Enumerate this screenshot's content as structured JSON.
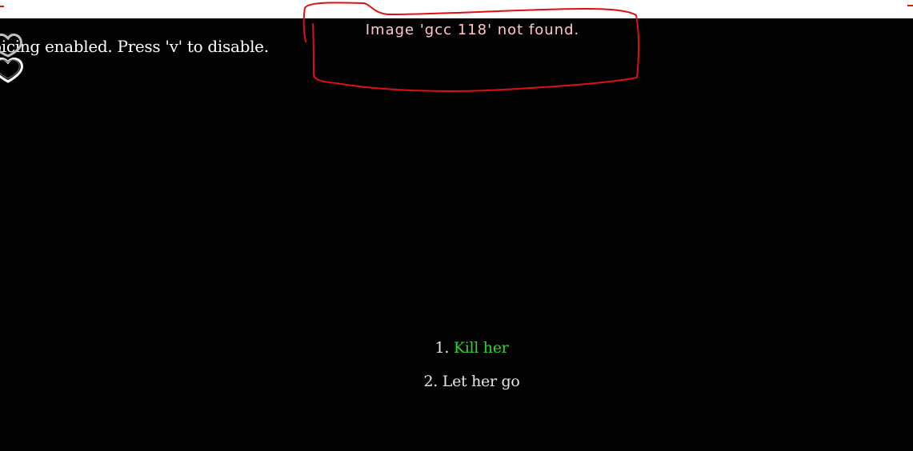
{
  "window": {
    "top_bar_color": "#ffffff"
  },
  "hud": {
    "voice_notice": "oicing enabled. Press 'v' to disable.",
    "voice_icon": "heart-outline-icon"
  },
  "error": {
    "message": "Image 'gcc 118' not found.",
    "color": "#ffc8c8",
    "annotation_color": "#e01010"
  },
  "menu": {
    "items": [
      {
        "number": "1.",
        "label": "Kill her",
        "color": "#2fd22f",
        "highlighted": true
      },
      {
        "number": "2.",
        "label": "Let her go",
        "color": "#e6e6e6",
        "highlighted": false
      }
    ]
  }
}
